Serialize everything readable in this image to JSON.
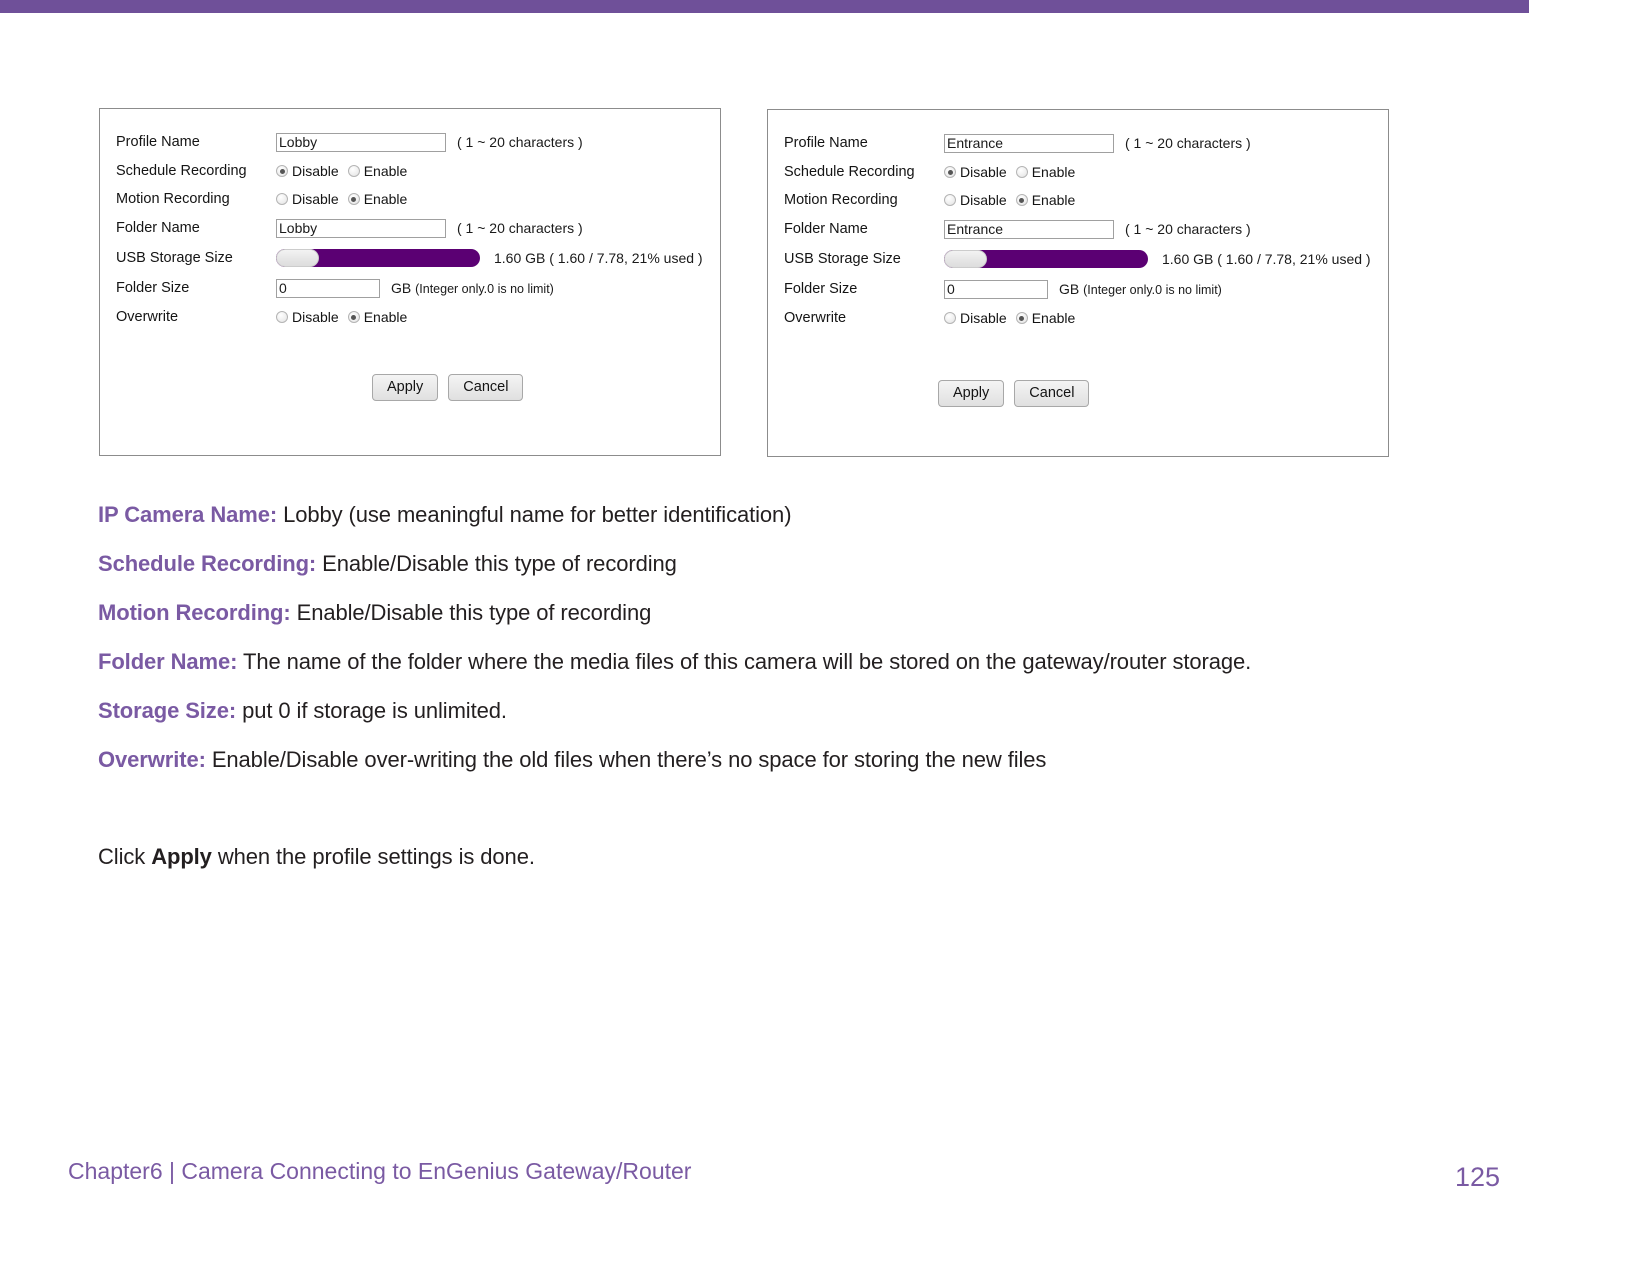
{
  "page": {
    "accent_purple": "#6f5099",
    "heading_purple": "#7a5aa3",
    "meter_purple": "#5b0073"
  },
  "panels": [
    {
      "id": "lobby",
      "rows": {
        "profile_name": {
          "label": "Profile Name",
          "value": "Lobby",
          "hint": "( 1 ~ 20 characters )"
        },
        "schedule_recording": {
          "label": "Schedule Recording",
          "options": [
            "Disable",
            "Enable"
          ],
          "selected": "Disable"
        },
        "motion_recording": {
          "label": "Motion Recording",
          "options": [
            "Disable",
            "Enable"
          ],
          "selected": "Enable"
        },
        "folder_name": {
          "label": "Folder Name",
          "value": "Lobby",
          "hint": "( 1 ~ 20 characters )"
        },
        "usb_storage_size": {
          "label": "USB Storage Size",
          "used_percent": 21,
          "text": "1.60 GB ( 1.60 / 7.78, 21% used )"
        },
        "folder_size": {
          "label": "Folder Size",
          "value": "0",
          "unit": "GB",
          "hint": "(Integer only.0 is no limit)"
        },
        "overwrite": {
          "label": "Overwrite",
          "options": [
            "Disable",
            "Enable"
          ],
          "selected": "Enable"
        }
      },
      "buttons": {
        "apply": "Apply",
        "cancel": "Cancel"
      }
    },
    {
      "id": "entrance",
      "rows": {
        "profile_name": {
          "label": "Profile Name",
          "value": "Entrance",
          "hint": "( 1 ~ 20 characters )"
        },
        "schedule_recording": {
          "label": "Schedule Recording",
          "options": [
            "Disable",
            "Enable"
          ],
          "selected": "Disable"
        },
        "motion_recording": {
          "label": "Motion Recording",
          "options": [
            "Disable",
            "Enable"
          ],
          "selected": "Enable"
        },
        "folder_name": {
          "label": "Folder Name",
          "value": "Entrance",
          "hint": "( 1 ~ 20 characters )"
        },
        "usb_storage_size": {
          "label": "USB Storage Size",
          "used_percent": 21,
          "text": "1.60 GB ( 1.60 / 7.78, 21% used )"
        },
        "folder_size": {
          "label": "Folder Size",
          "value": "0",
          "unit": "GB",
          "hint": "(Integer only.0 is no limit)"
        },
        "overwrite": {
          "label": "Overwrite",
          "options": [
            "Disable",
            "Enable"
          ],
          "selected": "Enable"
        }
      },
      "buttons": {
        "apply": "Apply",
        "cancel": "Cancel"
      }
    }
  ],
  "body": {
    "lines": [
      {
        "term": "IP Camera Name:",
        "text": " Lobby (use meaningful name for better identification)"
      },
      {
        "term": "Schedule Recording:",
        "text": " Enable/Disable this type of recording"
      },
      {
        "term": "Motion Recording:",
        "text": " Enable/Disable this type of recording"
      },
      {
        "term": "Folder Name:",
        "text": " The name of the folder where the media files of this camera will be stored on the gateway/router storage."
      },
      {
        "term": "Storage Size:",
        "text": " put 0 if storage is unlimited."
      },
      {
        "term": "Overwrite:",
        "text": " Enable/Disable over-writing the old files when there’s no space for storing the new files"
      }
    ],
    "closing": {
      "prefix": "Click ",
      "bold": "Apply",
      "suffix": " when the profile settings is done."
    }
  },
  "footer": {
    "chapter": "Chapter6  |  Camera Connecting to EnGenius Gateway/Router",
    "page_number": "125"
  }
}
